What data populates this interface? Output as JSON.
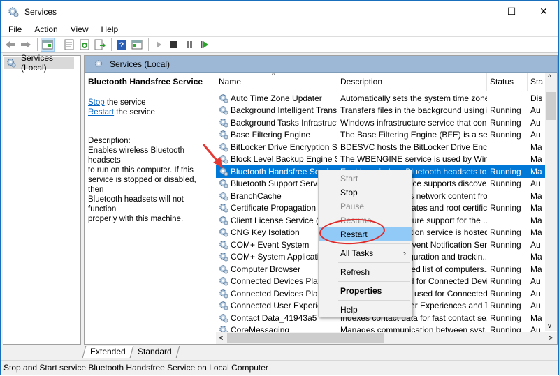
{
  "window": {
    "title": "Services",
    "controls": {
      "minimize": "—",
      "maximize": "☐",
      "close": "✕"
    }
  },
  "menu": [
    "File",
    "Action",
    "View",
    "Help"
  ],
  "toolbar": {
    "buttons": [
      "back-icon",
      "forward-icon",
      "show-hide-console-tree-icon",
      "properties-icon",
      "refresh-icon",
      "export-list-icon",
      "help-icon",
      "show-action-pane-icon",
      "start-service-icon",
      "stop-service-icon",
      "pause-service-icon",
      "restart-service-icon"
    ]
  },
  "left_pane": {
    "item": "Services (Local)"
  },
  "right_pane": {
    "header": "Services (Local)",
    "detail": {
      "service_name": "Bluetooth Handsfree Service",
      "stop_link": "Stop",
      "stop_suffix": " the service",
      "restart_link": "Restart",
      "restart_suffix": " the service",
      "description_label": "Description:",
      "description_lines": [
        "Enables wireless Bluetooth headsets",
        "to run on this computer. If this",
        "service is stopped or disabled, then",
        "Bluetooth headsets will not function",
        "properly with this machine."
      ]
    },
    "columns": [
      "Name",
      "Description",
      "Status",
      "Sta"
    ],
    "rows": [
      {
        "name": "Auto Time Zone Updater",
        "desc": "Automatically sets the system time zone.",
        "status": "",
        "startup": "Dis"
      },
      {
        "name": "Background Intelligent Transf...",
        "desc": "Transfers files in the background using i...",
        "status": "Running",
        "startup": "Au"
      },
      {
        "name": "Background Tasks Infrastruct...",
        "desc": "Windows infrastructure service that con...",
        "status": "Running",
        "startup": "Au"
      },
      {
        "name": "Base Filtering Engine",
        "desc": "The Base Filtering Engine (BFE) is a servi...",
        "status": "Running",
        "startup": "Au"
      },
      {
        "name": "BitLocker Drive Encryption Se...",
        "desc": "BDESVC hosts the BitLocker Drive Encry...",
        "status": "",
        "startup": "Ma"
      },
      {
        "name": "Block Level Backup Engine Se...",
        "desc": "The WBENGINE service is used by Wind...",
        "status": "",
        "startup": "Ma"
      },
      {
        "name": "Bluetooth Handsfree Service",
        "desc": "Enables wireless Bluetooth headsets to r...",
        "status": "Running",
        "startup": "Ma"
      },
      {
        "name": "Bluetooth Support Service",
        "desc": "The Bluetooth service supports discove...",
        "status": "Running",
        "startup": "Au"
      },
      {
        "name": "BranchCache",
        "desc": "This service caches network content fro...",
        "status": "",
        "startup": "Ma"
      },
      {
        "name": "Certificate Propagation",
        "desc": "Copies user certificates and root certific...",
        "status": "Running",
        "startup": "Ma"
      },
      {
        "name": "Client License Service (ClipSVC)",
        "desc": "Provides infrastructure support for the ...",
        "status": "",
        "startup": "Ma"
      },
      {
        "name": "CNG Key Isolation",
        "desc": "The CNG key isolation service is hosted ...",
        "status": "Running",
        "startup": "Ma"
      },
      {
        "name": "COM+ Event System",
        "desc": "Supports System Event Notification Ser...",
        "status": "Running",
        "startup": "Au"
      },
      {
        "name": "COM+ System Application",
        "desc": "Manages the configuration and trackin...",
        "status": "",
        "startup": "Ma"
      },
      {
        "name": "Computer Browser",
        "desc": "Maintains an updated list of computers...",
        "status": "Running",
        "startup": "Ma"
      },
      {
        "name": "Connected Devices Platform ...",
        "desc": "This service is used for Connected Devi...",
        "status": "Running",
        "startup": "Au"
      },
      {
        "name": "Connected Devices Platform ...",
        "desc": "This user service is used for Connected ...",
        "status": "Running",
        "startup": "Au"
      },
      {
        "name": "Connected User Experiences ...",
        "desc": "The Connected User Experiences and Te...",
        "status": "Running",
        "startup": "Au"
      },
      {
        "name": "Contact Data_41943a5",
        "desc": "Indexes contact data for fast contact se...",
        "status": "Running",
        "startup": "Ma"
      },
      {
        "name": "CoreMessaging",
        "desc": "Manages communication between syst...",
        "status": "Running",
        "startup": "Au"
      }
    ],
    "selected_row": 6
  },
  "tabs": [
    "Extended",
    "Standard"
  ],
  "context_menu": {
    "items": [
      {
        "label": "Start",
        "disabled": true
      },
      {
        "label": "Stop"
      },
      {
        "label": "Pause",
        "disabled": true
      },
      {
        "label": "Resume",
        "disabled": true
      },
      {
        "label": "Restart",
        "highlighted": true
      },
      {
        "separator": true
      },
      {
        "label": "All Tasks",
        "submenu": "›"
      },
      {
        "separator": true
      },
      {
        "label": "Refresh"
      },
      {
        "separator": true
      },
      {
        "label": "Properties",
        "bold": true
      },
      {
        "separator": true
      },
      {
        "label": "Help"
      }
    ]
  },
  "status_bar": "Stop and Start service Bluetooth Handsfree Service on Local Computer",
  "annotation_colors": {
    "arrow": "#e53935",
    "ring": "#e02a2a",
    "selection": "#0078d7",
    "menu_highlight": "#91c9f7"
  }
}
